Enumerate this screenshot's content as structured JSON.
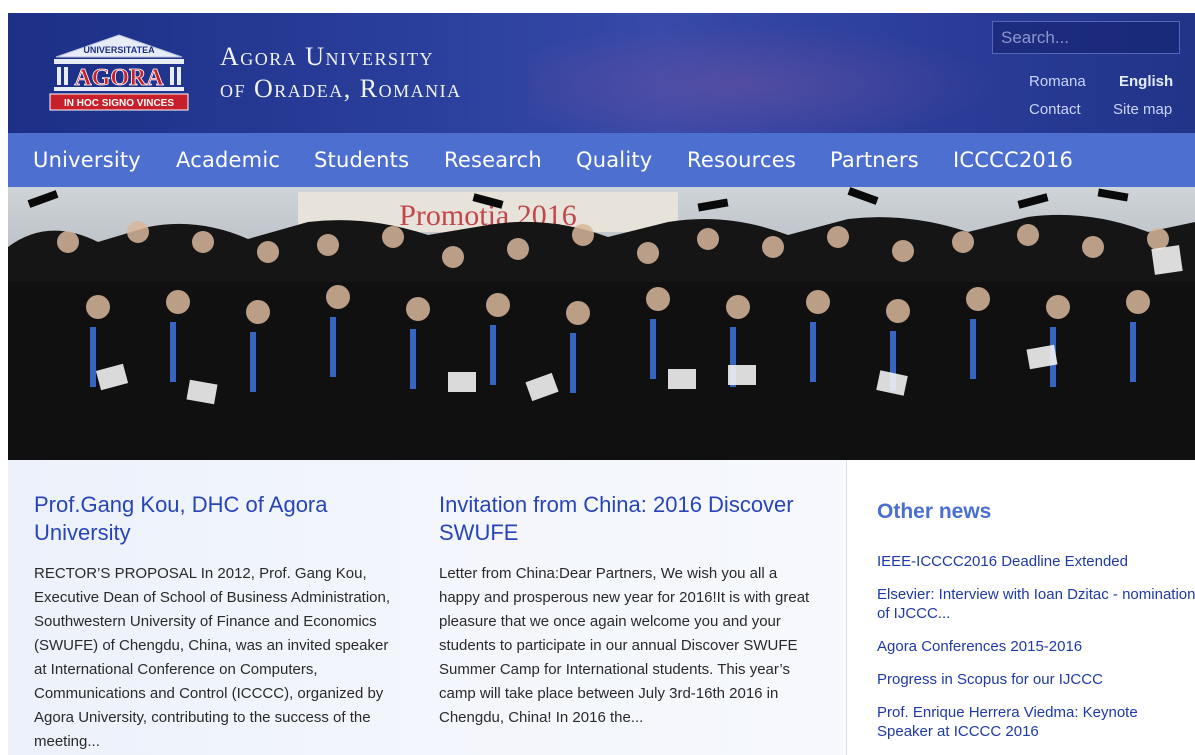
{
  "header": {
    "logo": {
      "top_text": "UNIVERSITATEA",
      "name": "AGORA",
      "motto": "IN HOC SIGNO VINCES"
    },
    "title_line1": "Agora University",
    "title_line2": "of Oradea, Romania",
    "search_placeholder": "Search...",
    "links": {
      "romana": "Romana",
      "english": "English",
      "contact": "Contact",
      "site_map": "Site map"
    }
  },
  "nav": {
    "items": [
      "University",
      "Academic",
      "Students",
      "Research",
      "Quality",
      "Resources",
      "Partners",
      "ICCCC2016"
    ]
  },
  "hero": {
    "banner_text": "Promotia 2016",
    "description_alt": ""
  },
  "articles": [
    {
      "title": "Prof.Gang Kou, DHC of Agora University",
      "body": "RECTOR’S PROPOSAL  In 2012, Prof. Gang Kou, Executive Dean of School of Business Administration, Southwestern University of Finance and Economics (SWUFE) of Chengdu, China, was an invited speaker at International Conference on Computers, Communications and Control (ICCCC), organized by Agora University, contributing to the success of the meeting..."
    },
    {
      "title": "Invitation from China: 2016 Discover SWUFE",
      "body": "Letter from China:Dear Partners, We wish you all a happy and prosperous new year for 2016!It is with great pleasure that we once again welcome you and your students to participate in our annual Discover SWUFE Summer Camp for International students. This year’s camp will take place between July 3rd-16th 2016 in Chengdu, China! In 2016 the..."
    }
  ],
  "other_news": {
    "heading": "Other news",
    "items": [
      "IEEE-ICCCC2016 Deadline Extended",
      "Elsevier: Interview with Ioan Dzitac - nomination of IJCCC...",
      "Agora Conferences 2015-2016",
      "Progress in Scopus for our IJCCC",
      "Prof. Enrique Herrera Viedma: Keynote Speaker at ICCCC 2016"
    ]
  },
  "colors": {
    "header_bg": "#2a3f9c",
    "nav_bg": "#4d6fd0",
    "title_blue": "#2845b8",
    "news_heading": "#4a6fd3",
    "logo_red": "#c8202a"
  }
}
